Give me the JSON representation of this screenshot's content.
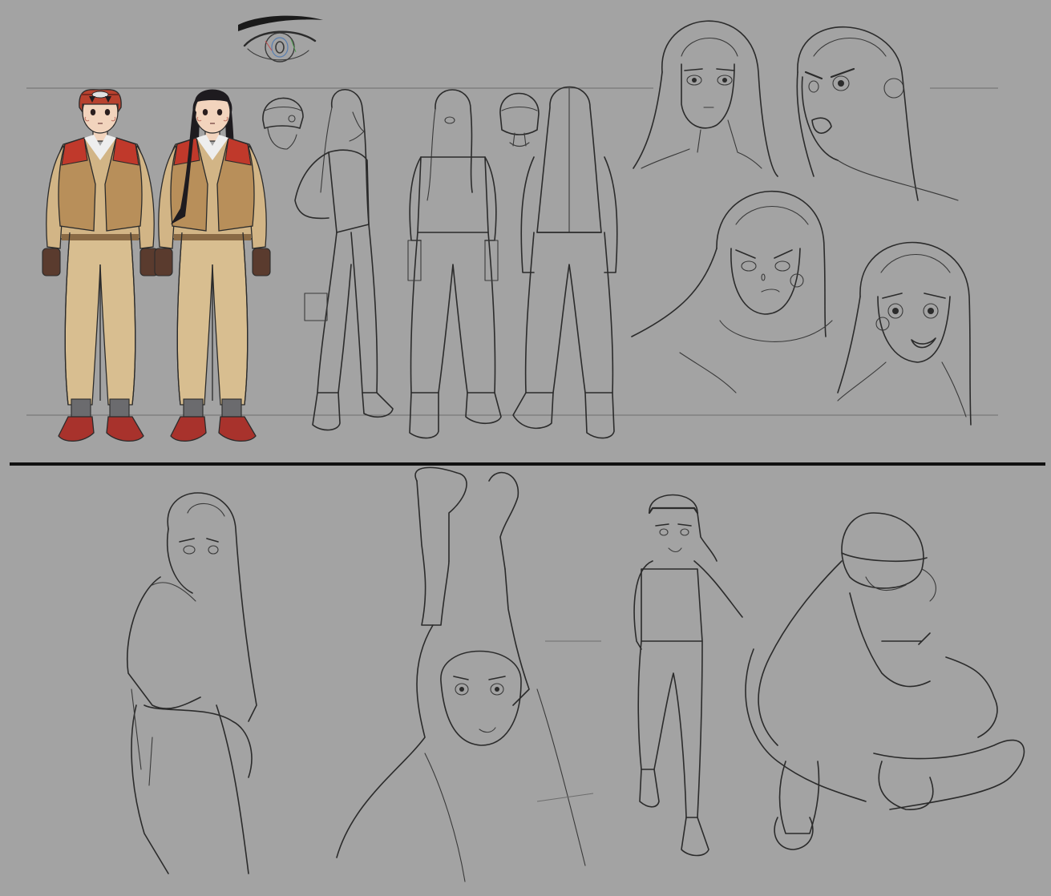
{
  "sheet": {
    "background": "#a3a3a3",
    "line_color": "#2b2b2b",
    "divider_color": "#111111",
    "palette": {
      "jacket": "#c9a878",
      "vest": "#b88f5a",
      "vest_trim": "#c0392b",
      "hat": "#b8412e",
      "hair": "#1e1b1f",
      "skin": "#f2d4bd",
      "gloves": "#5a3b2e",
      "socks": "#6b6b6e",
      "shoes": "#a8322c"
    },
    "sections": {
      "turnaround": [
        "color-front-with-hat",
        "color-front-hair-down",
        "side-view-sketch",
        "three-quarter-sketch",
        "back-view-sketch",
        "hat-detail-side",
        "hat-detail-back",
        "eye-detail"
      ],
      "expressions": [
        "neutral",
        "angry-shouting",
        "worried-sweating",
        "smiling"
      ],
      "poses": [
        "looking-back-over-shoulder",
        "arms-raised-stretch",
        "walking-with-hat",
        "sitting-with-tool"
      ]
    }
  }
}
